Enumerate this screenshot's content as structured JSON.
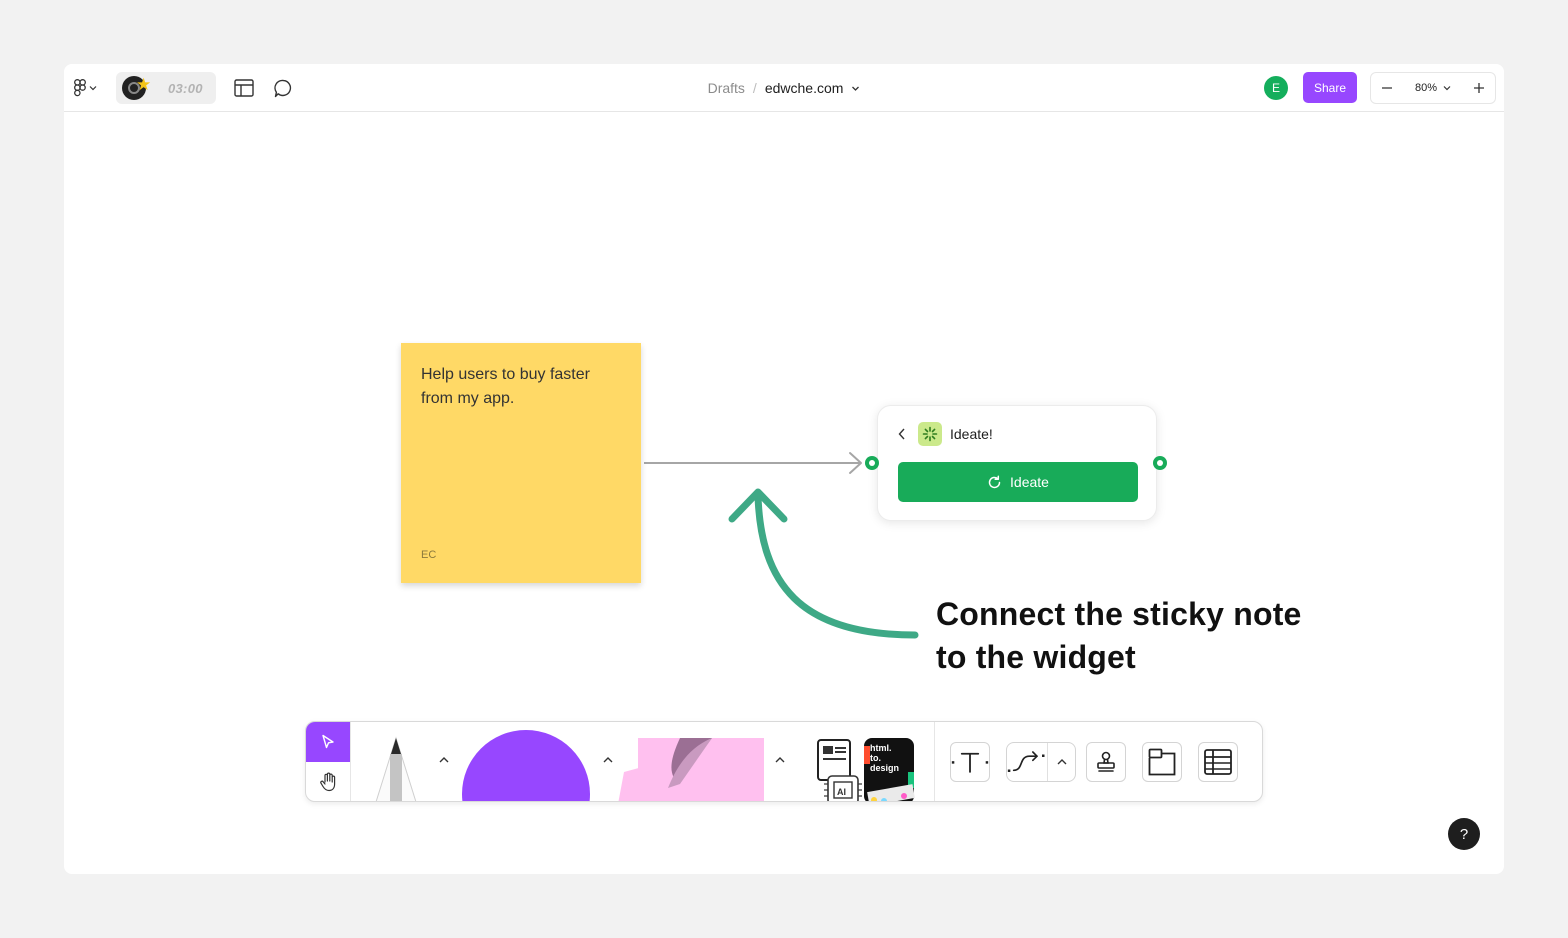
{
  "topbar": {
    "timer": "03:00",
    "breadcrumb_root": "Drafts",
    "breadcrumb_separator": "/",
    "file_name": "edwche.com",
    "user_initial": "E",
    "share_label": "Share",
    "zoom_level": "80%",
    "zoom_out_label": "−",
    "zoom_in_label": "+"
  },
  "sticky": {
    "text": "Help users to buy faster from my app.",
    "author": "EC"
  },
  "widget": {
    "title": "Ideate!",
    "button_label": "Ideate"
  },
  "annotation": {
    "line1": "Connect the sticky note",
    "line2": "to the widget"
  },
  "toolbar": {
    "widget_logo_text": "html. to. design",
    "ai_chip_text": "AI"
  },
  "help": {
    "label": "?"
  },
  "colors": {
    "accent": "#9747ff",
    "widget_green": "#18ab59",
    "sticky_yellow": "#ffd966",
    "sticky_pink": "#ffc0ef",
    "annotation_arrow": "#3ea986",
    "connector_gray": "#a6a6a6"
  }
}
